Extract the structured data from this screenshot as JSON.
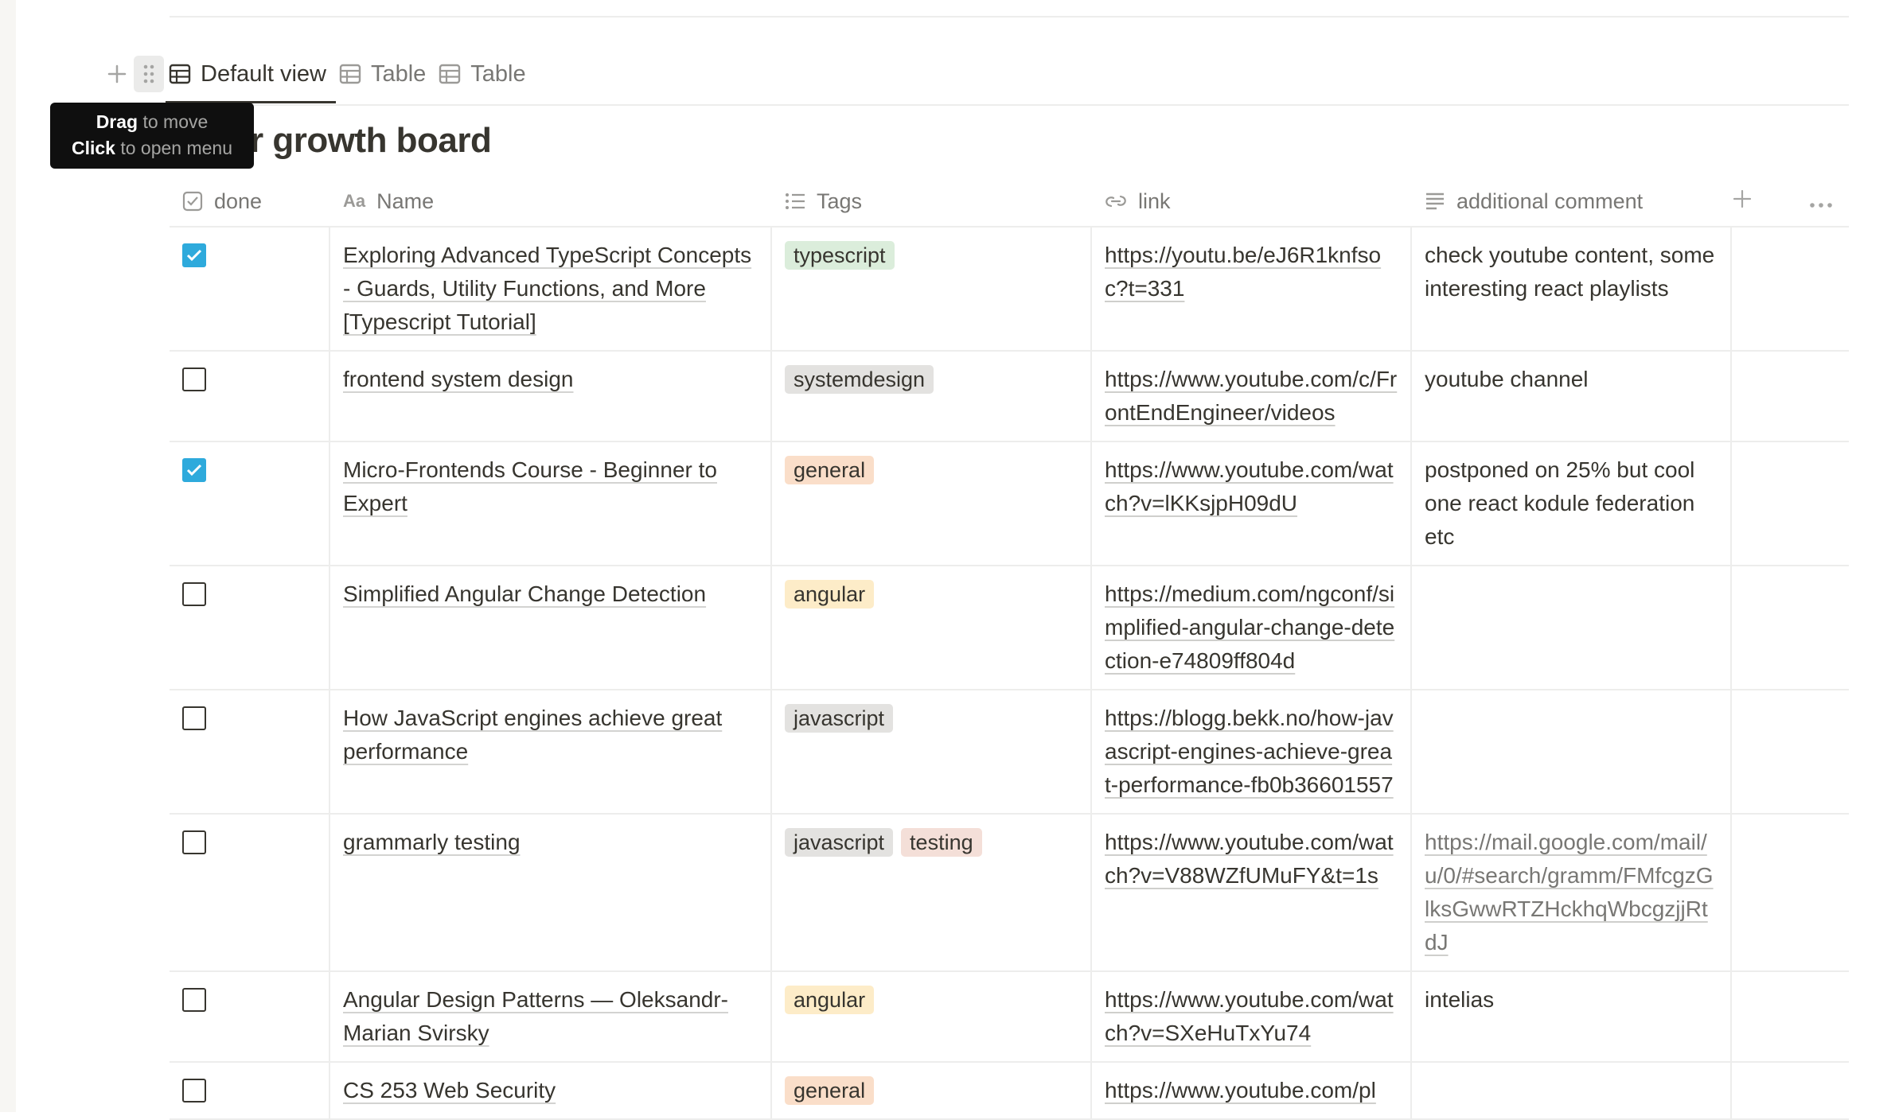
{
  "views": {
    "tabs": [
      {
        "label": "Default view",
        "active": true
      },
      {
        "label": "Table",
        "active": false
      },
      {
        "label": "Table",
        "active": false
      }
    ]
  },
  "tooltip": {
    "line1_bold": "Drag",
    "line1_rest": " to move",
    "line2_bold": "Click",
    "line2_rest": " to open menu"
  },
  "board_title": "er growth board",
  "columns": {
    "done": "done",
    "name": "Name",
    "tags": "Tags",
    "link": "link",
    "comment": "additional comment"
  },
  "tag_colors": {
    "typescript": "#dbeddb",
    "systemdesign": "#e3e2e0",
    "general": "#fadec9",
    "angular": "#fdecc8",
    "javascript": "#e3e2e0",
    "testing": "#f4dfd8"
  },
  "rows": [
    {
      "done": true,
      "name": "Exploring Advanced TypeScript Concepts - Guards, Utility Functions, and More [Typescript Tutorial]",
      "tags": [
        "typescript"
      ],
      "link": "https://youtu.be/eJ6R1knfsoc?t=331",
      "comment": "check youtube content, some interesting react playlists",
      "comment_is_link": false
    },
    {
      "done": false,
      "name": "frontend system design",
      "tags": [
        "systemdesign"
      ],
      "link": "https://www.youtube.com/c/FrontEndEngineer/videos",
      "comment": "youtube channel",
      "comment_is_link": false
    },
    {
      "done": true,
      "name": "Micro-Frontends Course - Beginner to Expert",
      "tags": [
        "general"
      ],
      "link": "https://www.youtube.com/watch?v=lKKsjpH09dU",
      "comment": "postponed on 25% but cool one react kodule federation etc",
      "comment_is_link": false
    },
    {
      "done": false,
      "name": "Simplified Angular Change Detection",
      "tags": [
        "angular"
      ],
      "link": "https://medium.com/ngconf/simplified-angular-change-detection-e74809ff804d",
      "comment": "",
      "comment_is_link": false
    },
    {
      "done": false,
      "name": "How JavaScript engines achieve great performance",
      "tags": [
        "javascript"
      ],
      "link": "https://blogg.bekk.no/how-javascript-engines-achieve-great-performance-fb0b36601557",
      "comment": "",
      "comment_is_link": false
    },
    {
      "done": false,
      "name": "grammarly testing",
      "tags": [
        "javascript",
        "testing"
      ],
      "link": "https://www.youtube.com/watch?v=V88WZfUMuFY&t=1s",
      "comment": "https://mail.google.com/mail/u/0/#search/gramm/FMfcgzGlksGwwRTZHckhqWbcgzjjRtdJ",
      "comment_is_link": true
    },
    {
      "done": false,
      "name": "Angular Design Patterns — Oleksandr-Marian Svirsky",
      "tags": [
        "angular"
      ],
      "link": "https://www.youtube.com/watch?v=SXeHuTxYu74",
      "comment": "intelias",
      "comment_is_link": false
    },
    {
      "done": false,
      "name": "CS 253 Web Security",
      "tags": [
        "general"
      ],
      "link": "https://www.youtube.com/pl",
      "comment": "",
      "comment_is_link": false
    }
  ]
}
